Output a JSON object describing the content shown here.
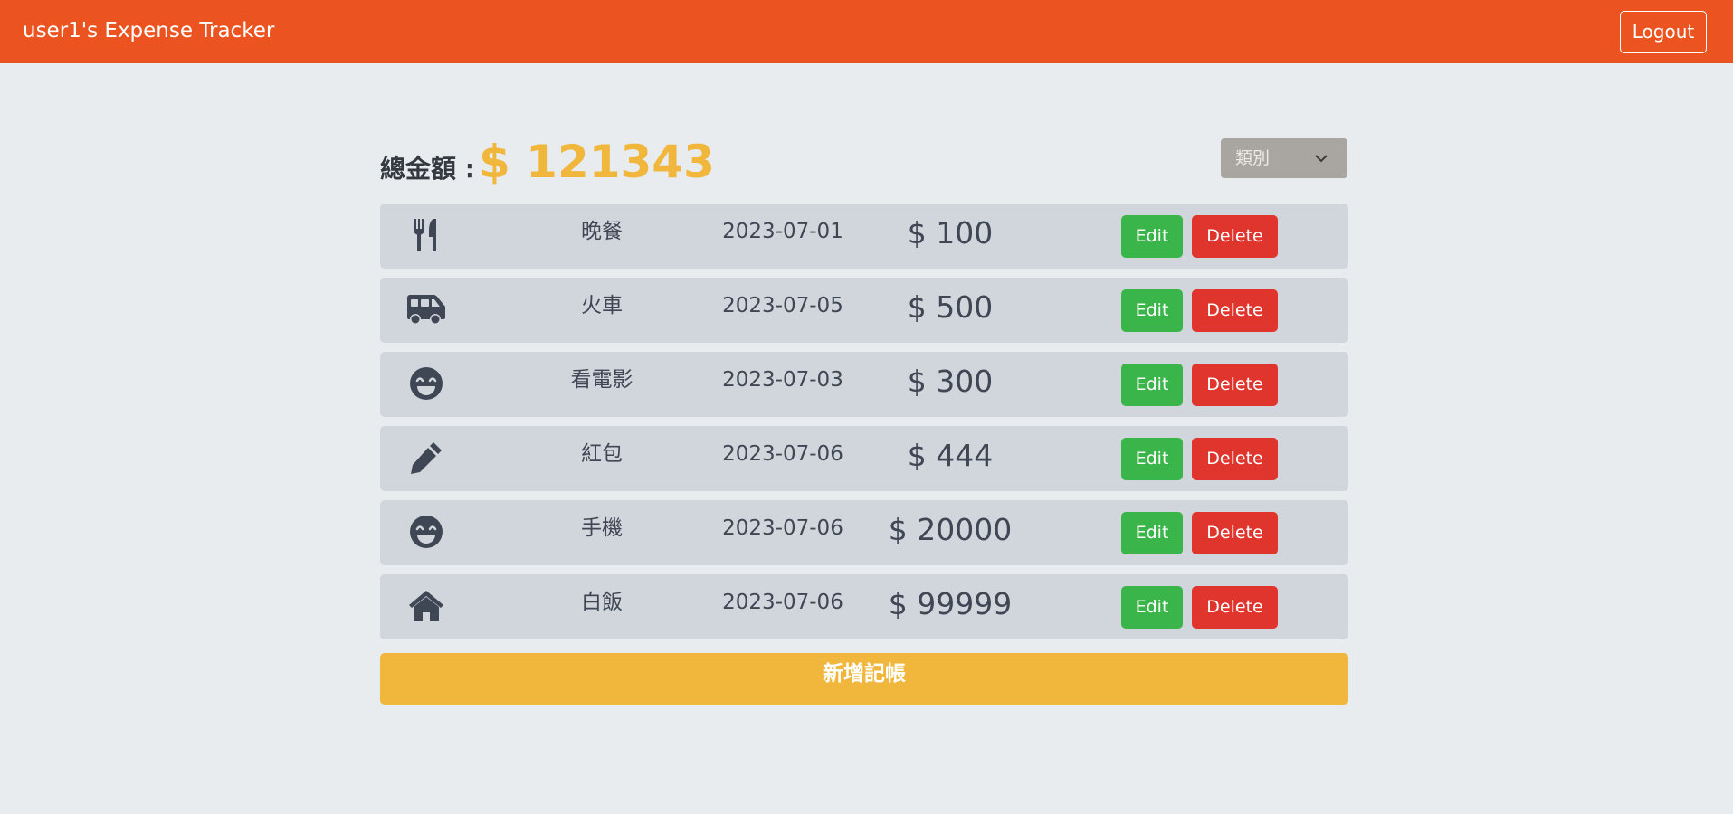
{
  "navbar": {
    "title": "user1's Expense Tracker",
    "logout_label": "Logout"
  },
  "summary": {
    "total_label": "總金額 :",
    "total_value": "$ 121343"
  },
  "filter": {
    "selected": "類別",
    "icon": "chevron-down-icon"
  },
  "records": [
    {
      "icon": "utensils-icon",
      "name": "晚餐",
      "date": "2023-07-01",
      "amount": "$ 100",
      "edit_label": "Edit",
      "delete_label": "Delete"
    },
    {
      "icon": "shuttle-van-icon",
      "name": "火車",
      "date": "2023-07-05",
      "amount": "$ 500",
      "edit_label": "Edit",
      "delete_label": "Delete"
    },
    {
      "icon": "grin-beam-icon",
      "name": "看電影",
      "date": "2023-07-03",
      "amount": "$ 300",
      "edit_label": "Edit",
      "delete_label": "Delete"
    },
    {
      "icon": "pen-icon",
      "name": "紅包",
      "date": "2023-07-06",
      "amount": "$ 444",
      "edit_label": "Edit",
      "delete_label": "Delete"
    },
    {
      "icon": "grin-beam-icon",
      "name": "手機",
      "date": "2023-07-06",
      "amount": "$ 20000",
      "edit_label": "Edit",
      "delete_label": "Delete"
    },
    {
      "icon": "home-icon",
      "name": "白飯",
      "date": "2023-07-06",
      "amount": "$ 99999",
      "edit_label": "Edit",
      "delete_label": "Delete"
    }
  ],
  "add_button_label": "新增記帳",
  "colors": {
    "navbar": "#eb5420",
    "accent": "#f0b73c",
    "edit": "#3ab549",
    "delete": "#e0352d",
    "row": "#d1d6dc",
    "icon": "#3f4654"
  }
}
